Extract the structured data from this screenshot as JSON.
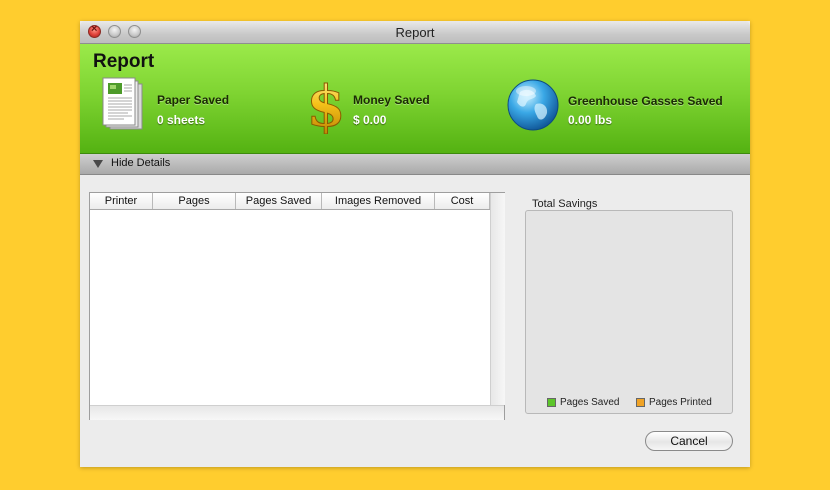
{
  "window": {
    "title": "Report"
  },
  "banner": {
    "title": "Report",
    "stats": [
      {
        "label": "Paper Saved",
        "value": "0 sheets",
        "icon": "paper-sheets-icon"
      },
      {
        "label": "Money Saved",
        "value": "$ 0.00",
        "icon": "dollar-sign-icon"
      },
      {
        "label": "Greenhouse Gasses Saved",
        "value": "0.00 lbs",
        "icon": "globe-icon"
      }
    ],
    "colors": {
      "top": "#9bea4a",
      "bottom": "#54b212"
    }
  },
  "details": {
    "label": "Hide Details"
  },
  "table": {
    "columns": [
      "Printer",
      "Pages",
      "Pages Saved",
      "Images Removed",
      "Cost"
    ],
    "rows": []
  },
  "savings": {
    "title": "Total Savings",
    "legend": [
      {
        "label": "Pages Saved",
        "color": "#5cc52a"
      },
      {
        "label": "Pages Printed",
        "color": "#f0a326"
      }
    ]
  },
  "buttons": {
    "cancel": "Cancel"
  }
}
